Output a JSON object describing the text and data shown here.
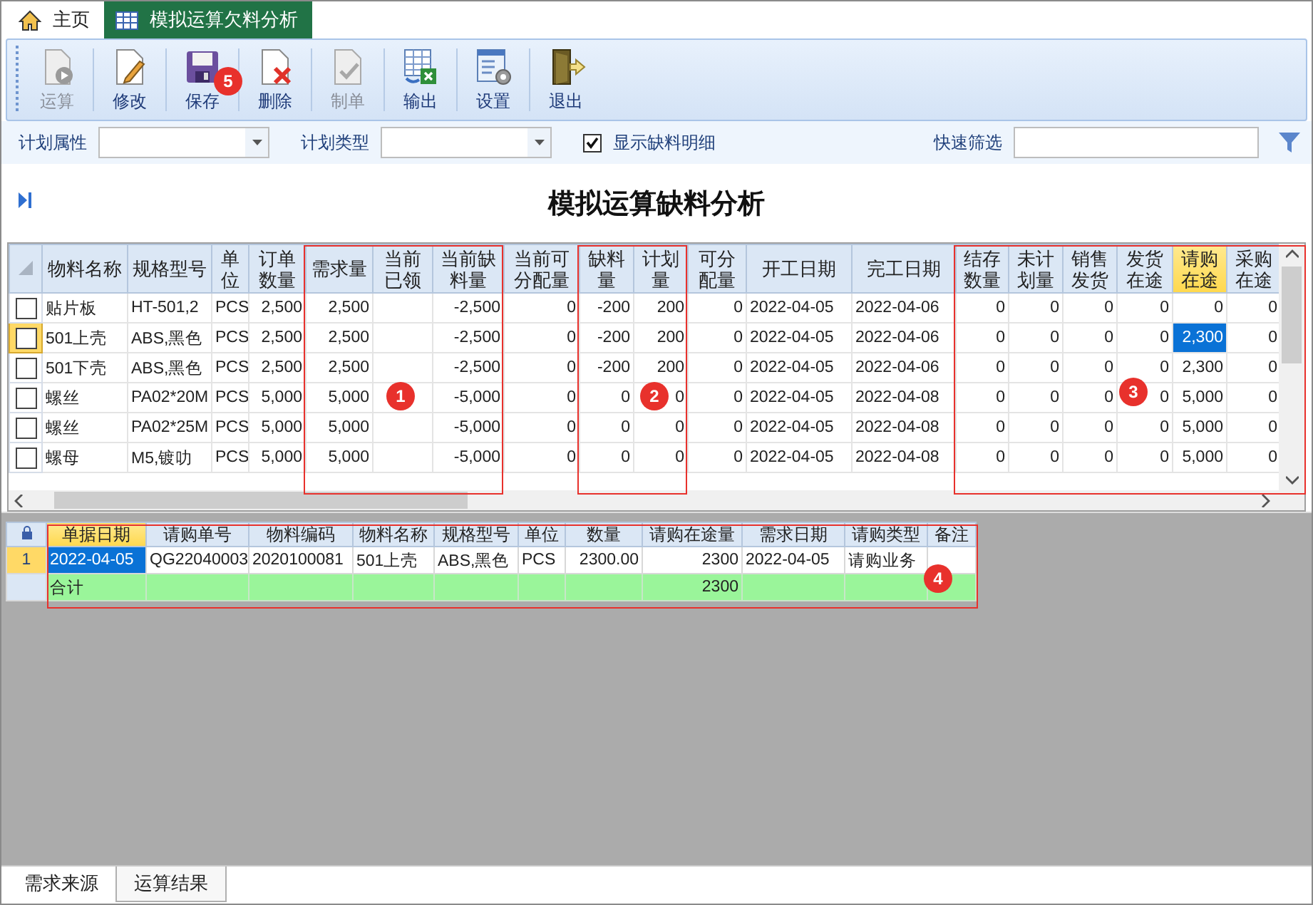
{
  "tabs": [
    {
      "label": "主页",
      "kind": "home",
      "selected": false
    },
    {
      "label": "模拟运算欠料分析",
      "kind": "table",
      "selected": true
    }
  ],
  "toolbar": [
    {
      "label": "运算",
      "kind": "run",
      "disabled": true
    },
    {
      "label": "修改",
      "kind": "edit",
      "disabled": false
    },
    {
      "label": "保存",
      "kind": "save",
      "disabled": false
    },
    {
      "label": "删除",
      "kind": "delete",
      "disabled": false
    },
    {
      "label": "制单",
      "kind": "approve",
      "disabled": true
    },
    {
      "label": "输出",
      "kind": "export",
      "disabled": false
    },
    {
      "label": "设置",
      "kind": "settings",
      "disabled": false
    },
    {
      "label": "退出",
      "kind": "exit",
      "disabled": false
    }
  ],
  "filters": {
    "plan_attribute": {
      "label": "计划属性"
    },
    "plan_type": {
      "label": "计划类型"
    },
    "show_detail": {
      "label": "显示缺料明细",
      "checked": true
    },
    "quick_filter": {
      "label": "快速筛选"
    }
  },
  "report_title": "模拟运算缺料分析",
  "main_grid": {
    "columns": [
      {
        "label": "物料名称",
        "kind": "text",
        "selected": false
      },
      {
        "label": "规格型号",
        "kind": "text",
        "selected": false
      },
      {
        "label": "单位",
        "kind": "text",
        "selected": false
      },
      {
        "label": "订单数量",
        "kind": "number",
        "selected": false
      },
      {
        "label": "需求量",
        "kind": "number",
        "selected": false
      },
      {
        "label": "当前已领",
        "kind": "number",
        "selected": false
      },
      {
        "label": "当前缺料量",
        "kind": "number",
        "selected": false
      },
      {
        "label": "当前可分配量",
        "kind": "number",
        "selected": false
      },
      {
        "label": "缺料量",
        "kind": "number",
        "selected": false
      },
      {
        "label": "计划量",
        "kind": "number",
        "selected": false
      },
      {
        "label": "可分配量",
        "kind": "number",
        "selected": false
      },
      {
        "label": "开工日期",
        "kind": "text",
        "selected": false
      },
      {
        "label": "完工日期",
        "kind": "text",
        "selected": false
      },
      {
        "label": "结存数量",
        "kind": "number",
        "selected": false
      },
      {
        "label": "未计划量",
        "kind": "number",
        "selected": false
      },
      {
        "label": "销售发货",
        "kind": "number",
        "selected": false
      },
      {
        "label": "发货在途",
        "kind": "number",
        "selected": false
      },
      {
        "label": "请购在途",
        "kind": "number",
        "selected": true
      },
      {
        "label": "采购在途",
        "kind": "number",
        "selected": false
      }
    ],
    "rows": [
      {
        "checked": false,
        "selected": false,
        "cells": [
          "贴片板",
          "HT-501,2",
          "PCS",
          "2,500",
          "2,500",
          null,
          "-2,500",
          "0",
          "-200",
          "200",
          "0",
          "2022-04-05",
          "2022-04-06",
          "0",
          "0",
          "0",
          "0",
          "0",
          "0"
        ]
      },
      {
        "checked": false,
        "selected": true,
        "cells": [
          "501上壳",
          "ABS,黑色",
          "PCS",
          "2,500",
          "2,500",
          null,
          "-2,500",
          "0",
          "-200",
          "200",
          "0",
          "2022-04-05",
          "2022-04-06",
          "0",
          "0",
          "0",
          "0",
          "2,300",
          "0"
        ]
      },
      {
        "checked": false,
        "selected": false,
        "cells": [
          "501下壳",
          "ABS,黑色",
          "PCS",
          "2,500",
          "2,500",
          null,
          "-2,500",
          "0",
          "-200",
          "200",
          "0",
          "2022-04-05",
          "2022-04-06",
          "0",
          "0",
          "0",
          "0",
          "2,300",
          "0"
        ]
      },
      {
        "checked": false,
        "selected": false,
        "cells": [
          "螺丝",
          "PA02*20M",
          "PCS",
          "5,000",
          "5,000",
          null,
          "-5,000",
          "0",
          "0",
          "0",
          "0",
          "2022-04-05",
          "2022-04-08",
          "0",
          "0",
          "0",
          "0",
          "5,000",
          "0"
        ]
      },
      {
        "checked": false,
        "selected": false,
        "cells": [
          "螺丝",
          "PA02*25M",
          "PCS",
          "5,000",
          "5,000",
          null,
          "-5,000",
          "0",
          "0",
          "0",
          "0",
          "2022-04-05",
          "2022-04-08",
          "0",
          "0",
          "0",
          "0",
          "5,000",
          "0"
        ]
      },
      {
        "checked": false,
        "selected": false,
        "cells": [
          "螺母",
          "M5,镀叻",
          "PCS",
          "5,000",
          "5,000",
          null,
          "-5,000",
          "0",
          "0",
          "0",
          "0",
          "2022-04-05",
          "2022-04-08",
          "0",
          "0",
          "0",
          "0",
          "5,000",
          "0"
        ]
      }
    ]
  },
  "detail_grid": {
    "columns": [
      {
        "label": "单据日期",
        "kind": "text",
        "selected": true
      },
      {
        "label": "请购单号",
        "kind": "text",
        "selected": false
      },
      {
        "label": "物料编码",
        "kind": "text",
        "selected": false
      },
      {
        "label": "物料名称",
        "kind": "text",
        "selected": false
      },
      {
        "label": "规格型号",
        "kind": "text",
        "selected": false
      },
      {
        "label": "单位",
        "kind": "text",
        "selected": false
      },
      {
        "label": "数量",
        "kind": "number",
        "selected": false
      },
      {
        "label": "请购在途量",
        "kind": "number",
        "selected": false
      },
      {
        "label": "需求日期",
        "kind": "text",
        "selected": false
      },
      {
        "label": "请购类型",
        "kind": "text",
        "selected": false
      },
      {
        "label": "备注",
        "kind": "text",
        "selected": false
      }
    ],
    "rows": [
      {
        "number": "1",
        "selected": true,
        "cells": [
          "2022-04-05",
          "QG22040003",
          "2020100081",
          "501上壳",
          "ABS,黑色",
          "PCS",
          "2300.00",
          "2300",
          "2022-04-05",
          "请购业务",
          null
        ]
      }
    ],
    "total": {
      "cells": [
        "合计",
        null,
        null,
        null,
        null,
        null,
        null,
        "2300",
        null,
        null,
        null
      ]
    }
  },
  "bottom_tabs": [
    {
      "label": "需求来源",
      "selected": true
    },
    {
      "label": "运算结果",
      "selected": false
    }
  ],
  "annotations": [
    {
      "label": "5",
      "framed": false
    },
    {
      "label": "1",
      "framed": true
    },
    {
      "label": "2",
      "framed": true
    },
    {
      "label": "3",
      "framed": true
    },
    {
      "label": "4",
      "framed": true
    }
  ]
}
